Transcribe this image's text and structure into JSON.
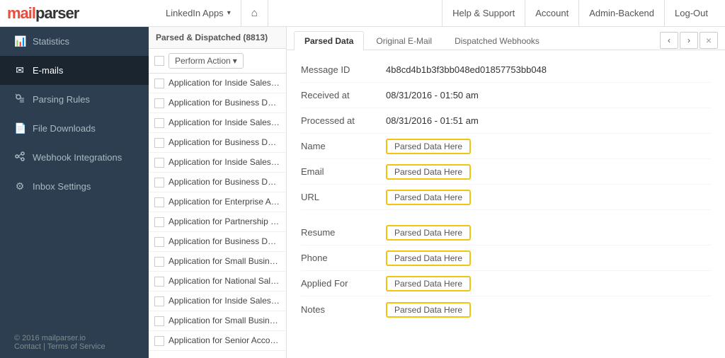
{
  "logo": {
    "text_red": "mail",
    "text_black": "parser"
  },
  "top_nav": {
    "center_items": [
      {
        "label": "LinkedIn Apps",
        "has_dropdown": true
      },
      {
        "label": "🏠",
        "is_home": true
      }
    ],
    "right_items": [
      {
        "label": "Help & Support"
      },
      {
        "label": "Account"
      },
      {
        "label": "Admin-Backend"
      },
      {
        "label": "Log-Out"
      }
    ]
  },
  "sidebar": {
    "items": [
      {
        "id": "statistics",
        "label": "Statistics",
        "icon": "📊"
      },
      {
        "id": "emails",
        "label": "E-mails",
        "icon": "✉",
        "active": true
      },
      {
        "id": "parsing-rules",
        "label": "Parsing Rules",
        "icon": "🔧"
      },
      {
        "id": "file-downloads",
        "label": "File Downloads",
        "icon": "📄"
      },
      {
        "id": "webhook-integrations",
        "label": "Webhook Integrations",
        "icon": "🔗"
      },
      {
        "id": "inbox-settings",
        "label": "Inbox Settings",
        "icon": "⚙"
      }
    ],
    "footer": {
      "copyright": "© 2016 mailparser.io",
      "links": [
        "Contact",
        "Terms of Service"
      ]
    }
  },
  "email_list": {
    "header": "Parsed & Dispatched (8813)",
    "toolbar": {
      "action_button": "Perform Action"
    },
    "items": [
      {
        "text": "Application for Inside Sales fro..."
      },
      {
        "text": "Application for Business Deve..."
      },
      {
        "text": "Application for Inside Sales fro..."
      },
      {
        "text": "Application for Business Deve..."
      },
      {
        "text": "Application for Inside Sales fro..."
      },
      {
        "text": "Application for Business Deve..."
      },
      {
        "text": "Application for Enterprise Acc..."
      },
      {
        "text": "Application for Partnership Sa..."
      },
      {
        "text": "Application for Business Deve..."
      },
      {
        "text": "Application for Small Business..."
      },
      {
        "text": "Application for National Sales ..."
      },
      {
        "text": "Application for Inside Sales fro..."
      },
      {
        "text": "Application for Small Business..."
      },
      {
        "text": "Application for Senior Account..."
      }
    ]
  },
  "detail": {
    "tabs": [
      {
        "label": "Parsed Data",
        "active": true
      },
      {
        "label": "Original E-Mail",
        "active": false
      },
      {
        "label": "Dispatched Webhooks",
        "active": false
      }
    ],
    "nav_buttons": [
      "‹",
      "›",
      "×"
    ],
    "fields": [
      {
        "label": "Message ID",
        "value": "4b8cd4b1b3f3bb048ed01857753bb048",
        "type": "text"
      },
      {
        "label": "Received at",
        "value": "08/31/2016 - 01:50 am",
        "type": "text"
      },
      {
        "label": "Processed at",
        "value": "08/31/2016 - 01:51 am",
        "type": "text"
      },
      {
        "label": "Name",
        "value": "Parsed Data Here",
        "type": "parsed"
      },
      {
        "label": "Email",
        "value": "Parsed Data Here",
        "type": "parsed"
      },
      {
        "label": "URL",
        "value": "Parsed Data Here",
        "type": "parsed"
      },
      {
        "spacer": true
      },
      {
        "label": "Resume",
        "value": "Parsed Data Here",
        "type": "parsed"
      },
      {
        "label": "Phone",
        "value": "Parsed Data Here",
        "type": "parsed"
      },
      {
        "label": "Applied For",
        "value": "Parsed Data Here",
        "type": "parsed"
      },
      {
        "label": "Notes",
        "value": "Parsed Data Here",
        "type": "parsed"
      }
    ]
  }
}
